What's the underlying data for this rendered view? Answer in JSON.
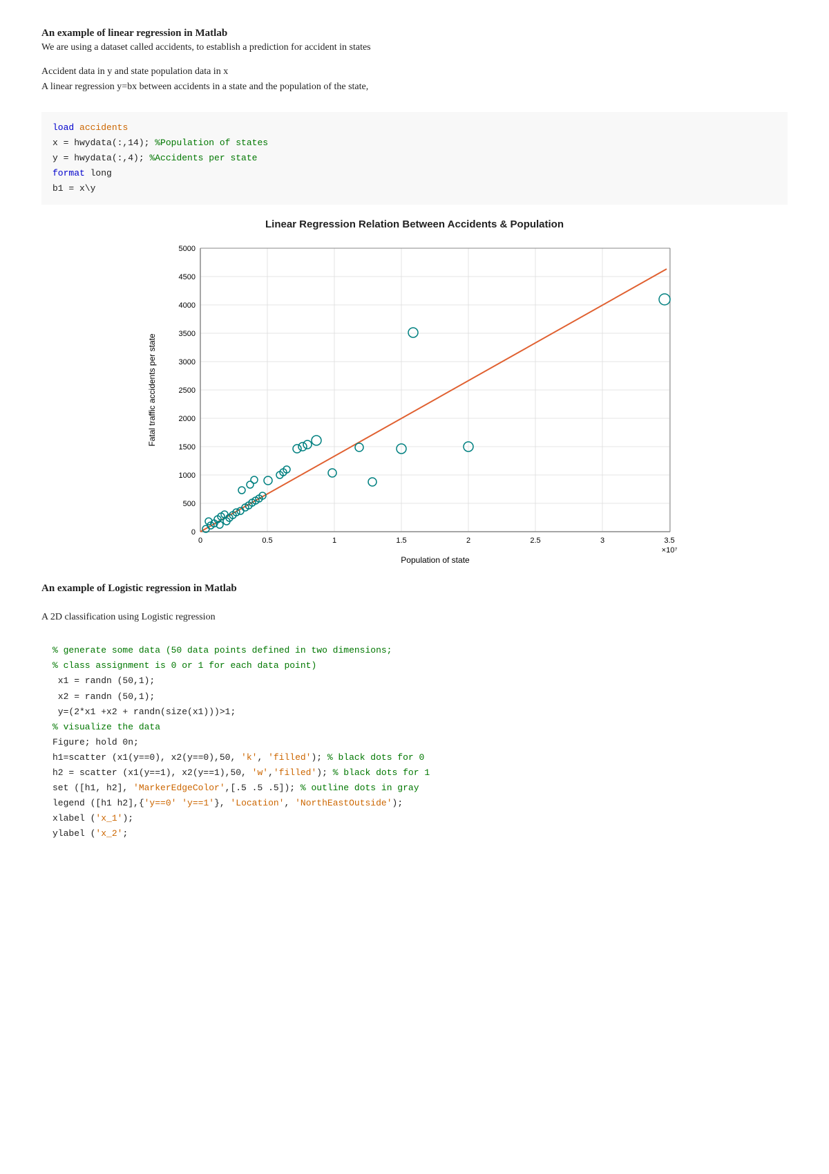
{
  "linearSection": {
    "title": "An example of linear regression in Matlab",
    "desc": "We are using a dataset called accidents, to establish a prediction for accident in states",
    "info_line1": "Accident data in y and state population data in x",
    "info_line2": "A linear regression y=bx between accidents in a state and the population of the state,",
    "chart_title": "Linear Regression Relation Between Accidents & Population",
    "x_label": "Population of state",
    "y_label": "Fatal traffic accidents per state",
    "x_scale": "×10⁷",
    "x_ticks": [
      "0",
      "0.5",
      "1",
      "1.5",
      "2",
      "2.5",
      "3",
      "3.5"
    ],
    "y_ticks": [
      "0",
      "500",
      "1000",
      "1500",
      "2000",
      "2500",
      "3000",
      "3500",
      "4000",
      "4500",
      "5000"
    ]
  },
  "logisticSection": {
    "title": "An example of Logistic regression in Matlab",
    "desc": "A 2D classification using Logistic regression"
  },
  "icons": {}
}
